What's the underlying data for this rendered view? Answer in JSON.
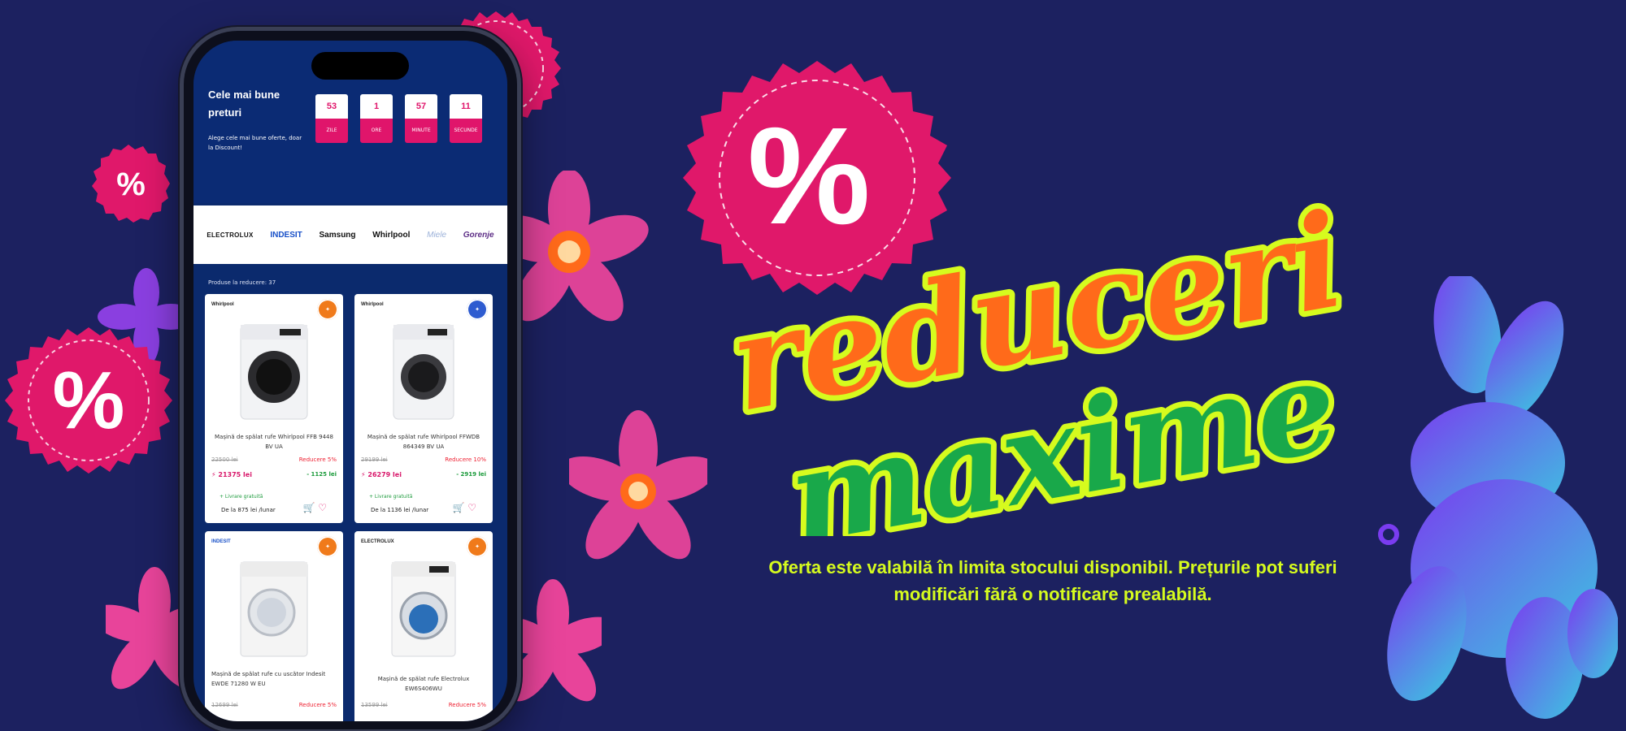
{
  "phone": {
    "hero": {
      "title": "Cele mai bune preturi",
      "subtitle": "Alege cele mai bune oferte, doar la Discount!"
    },
    "countdown": [
      {
        "value": "53",
        "label": "ZILE"
      },
      {
        "value": "1",
        "label": "ORE"
      },
      {
        "value": "57",
        "label": "MINUTE"
      },
      {
        "value": "11",
        "label": "SECUNDE"
      }
    ],
    "brands": [
      "ELECTROLUX",
      "INDESIT",
      "Samsung",
      "Whirlpool",
      "Miele",
      "Gorenje"
    ],
    "list_header": "Produse la reducere: 37",
    "products": [
      {
        "brand": "Whirlpool",
        "name": "Mașină de spălat rufe Whirlpool FFB 9448 BV UA",
        "old_price": "22500 lei",
        "discount": "Reducere 5%",
        "new_price": "21375 lei",
        "saving": "- 1125 lei",
        "shipping": "+ Livrare gratuită",
        "installment": "De la 875 lei /lunar"
      },
      {
        "brand": "Whirlpool",
        "name": "Mașină de spălat rufe Whirlpool FFWDB 864349 BV UA",
        "old_price": "29199 lei",
        "discount": "Reducere 10%",
        "new_price": "26279 lei",
        "saving": "- 2919 lei",
        "shipping": "+ Livrare gratuită",
        "installment": "De la 1136 lei /lunar"
      },
      {
        "brand": "INDESIT",
        "name": "Mașină de spălat rufe cu uscător Indesit EWDE 71280 W EU",
        "old_price": "12699 lei",
        "discount": "Reducere 5%"
      },
      {
        "brand": "ELECTROLUX",
        "name": "Mașină de spălat rufe Electrolux EW6S406WU",
        "old_price": "13599 lei",
        "discount": "Reducere 5%"
      }
    ]
  },
  "headline": {
    "line1": "reduceri",
    "line2": "maxime"
  },
  "percent_symbol": "%",
  "disclaimer": "Oferta este valabilă în limita stocului disponibil. Prețurile pot suferi modificări fără o notificare prealabilă.",
  "colors": {
    "background": "#1c2160",
    "badge_pink": "#e0186a",
    "headline_orange": "#ff6a1a",
    "headline_green": "#19a84a",
    "headline_outline": "#d6fb1e",
    "disclaimer": "#d6fb1e"
  }
}
